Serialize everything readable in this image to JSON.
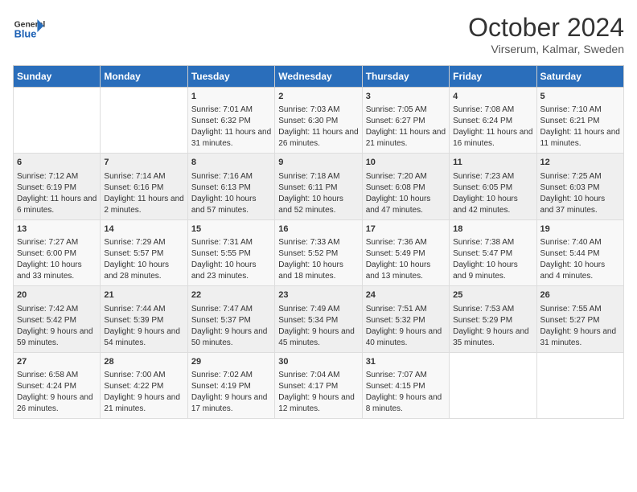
{
  "header": {
    "logo_general": "General",
    "logo_blue": "Blue",
    "title": "October 2024",
    "subtitle": "Virserum, Kalmar, Sweden"
  },
  "days_of_week": [
    "Sunday",
    "Monday",
    "Tuesday",
    "Wednesday",
    "Thursday",
    "Friday",
    "Saturday"
  ],
  "weeks": [
    [
      {
        "day": "",
        "sunrise": "",
        "sunset": "",
        "daylight": ""
      },
      {
        "day": "",
        "sunrise": "",
        "sunset": "",
        "daylight": ""
      },
      {
        "day": "1",
        "sunrise": "Sunrise: 7:01 AM",
        "sunset": "Sunset: 6:32 PM",
        "daylight": "Daylight: 11 hours and 31 minutes."
      },
      {
        "day": "2",
        "sunrise": "Sunrise: 7:03 AM",
        "sunset": "Sunset: 6:30 PM",
        "daylight": "Daylight: 11 hours and 26 minutes."
      },
      {
        "day": "3",
        "sunrise": "Sunrise: 7:05 AM",
        "sunset": "Sunset: 6:27 PM",
        "daylight": "Daylight: 11 hours and 21 minutes."
      },
      {
        "day": "4",
        "sunrise": "Sunrise: 7:08 AM",
        "sunset": "Sunset: 6:24 PM",
        "daylight": "Daylight: 11 hours and 16 minutes."
      },
      {
        "day": "5",
        "sunrise": "Sunrise: 7:10 AM",
        "sunset": "Sunset: 6:21 PM",
        "daylight": "Daylight: 11 hours and 11 minutes."
      }
    ],
    [
      {
        "day": "6",
        "sunrise": "Sunrise: 7:12 AM",
        "sunset": "Sunset: 6:19 PM",
        "daylight": "Daylight: 11 hours and 6 minutes."
      },
      {
        "day": "7",
        "sunrise": "Sunrise: 7:14 AM",
        "sunset": "Sunset: 6:16 PM",
        "daylight": "Daylight: 11 hours and 2 minutes."
      },
      {
        "day": "8",
        "sunrise": "Sunrise: 7:16 AM",
        "sunset": "Sunset: 6:13 PM",
        "daylight": "Daylight: 10 hours and 57 minutes."
      },
      {
        "day": "9",
        "sunrise": "Sunrise: 7:18 AM",
        "sunset": "Sunset: 6:11 PM",
        "daylight": "Daylight: 10 hours and 52 minutes."
      },
      {
        "day": "10",
        "sunrise": "Sunrise: 7:20 AM",
        "sunset": "Sunset: 6:08 PM",
        "daylight": "Daylight: 10 hours and 47 minutes."
      },
      {
        "day": "11",
        "sunrise": "Sunrise: 7:23 AM",
        "sunset": "Sunset: 6:05 PM",
        "daylight": "Daylight: 10 hours and 42 minutes."
      },
      {
        "day": "12",
        "sunrise": "Sunrise: 7:25 AM",
        "sunset": "Sunset: 6:03 PM",
        "daylight": "Daylight: 10 hours and 37 minutes."
      }
    ],
    [
      {
        "day": "13",
        "sunrise": "Sunrise: 7:27 AM",
        "sunset": "Sunset: 6:00 PM",
        "daylight": "Daylight: 10 hours and 33 minutes."
      },
      {
        "day": "14",
        "sunrise": "Sunrise: 7:29 AM",
        "sunset": "Sunset: 5:57 PM",
        "daylight": "Daylight: 10 hours and 28 minutes."
      },
      {
        "day": "15",
        "sunrise": "Sunrise: 7:31 AM",
        "sunset": "Sunset: 5:55 PM",
        "daylight": "Daylight: 10 hours and 23 minutes."
      },
      {
        "day": "16",
        "sunrise": "Sunrise: 7:33 AM",
        "sunset": "Sunset: 5:52 PM",
        "daylight": "Daylight: 10 hours and 18 minutes."
      },
      {
        "day": "17",
        "sunrise": "Sunrise: 7:36 AM",
        "sunset": "Sunset: 5:49 PM",
        "daylight": "Daylight: 10 hours and 13 minutes."
      },
      {
        "day": "18",
        "sunrise": "Sunrise: 7:38 AM",
        "sunset": "Sunset: 5:47 PM",
        "daylight": "Daylight: 10 hours and 9 minutes."
      },
      {
        "day": "19",
        "sunrise": "Sunrise: 7:40 AM",
        "sunset": "Sunset: 5:44 PM",
        "daylight": "Daylight: 10 hours and 4 minutes."
      }
    ],
    [
      {
        "day": "20",
        "sunrise": "Sunrise: 7:42 AM",
        "sunset": "Sunset: 5:42 PM",
        "daylight": "Daylight: 9 hours and 59 minutes."
      },
      {
        "day": "21",
        "sunrise": "Sunrise: 7:44 AM",
        "sunset": "Sunset: 5:39 PM",
        "daylight": "Daylight: 9 hours and 54 minutes."
      },
      {
        "day": "22",
        "sunrise": "Sunrise: 7:47 AM",
        "sunset": "Sunset: 5:37 PM",
        "daylight": "Daylight: 9 hours and 50 minutes."
      },
      {
        "day": "23",
        "sunrise": "Sunrise: 7:49 AM",
        "sunset": "Sunset: 5:34 PM",
        "daylight": "Daylight: 9 hours and 45 minutes."
      },
      {
        "day": "24",
        "sunrise": "Sunrise: 7:51 AM",
        "sunset": "Sunset: 5:32 PM",
        "daylight": "Daylight: 9 hours and 40 minutes."
      },
      {
        "day": "25",
        "sunrise": "Sunrise: 7:53 AM",
        "sunset": "Sunset: 5:29 PM",
        "daylight": "Daylight: 9 hours and 35 minutes."
      },
      {
        "day": "26",
        "sunrise": "Sunrise: 7:55 AM",
        "sunset": "Sunset: 5:27 PM",
        "daylight": "Daylight: 9 hours and 31 minutes."
      }
    ],
    [
      {
        "day": "27",
        "sunrise": "Sunrise: 6:58 AM",
        "sunset": "Sunset: 4:24 PM",
        "daylight": "Daylight: 9 hours and 26 minutes."
      },
      {
        "day": "28",
        "sunrise": "Sunrise: 7:00 AM",
        "sunset": "Sunset: 4:22 PM",
        "daylight": "Daylight: 9 hours and 21 minutes."
      },
      {
        "day": "29",
        "sunrise": "Sunrise: 7:02 AM",
        "sunset": "Sunset: 4:19 PM",
        "daylight": "Daylight: 9 hours and 17 minutes."
      },
      {
        "day": "30",
        "sunrise": "Sunrise: 7:04 AM",
        "sunset": "Sunset: 4:17 PM",
        "daylight": "Daylight: 9 hours and 12 minutes."
      },
      {
        "day": "31",
        "sunrise": "Sunrise: 7:07 AM",
        "sunset": "Sunset: 4:15 PM",
        "daylight": "Daylight: 9 hours and 8 minutes."
      },
      {
        "day": "",
        "sunrise": "",
        "sunset": "",
        "daylight": ""
      },
      {
        "day": "",
        "sunrise": "",
        "sunset": "",
        "daylight": ""
      }
    ]
  ]
}
